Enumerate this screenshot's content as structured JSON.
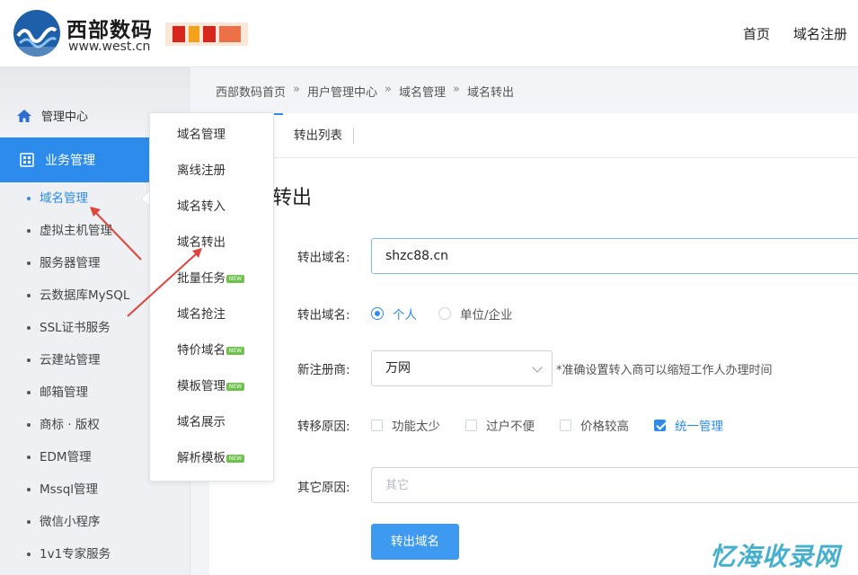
{
  "header": {
    "logo_cn": "西部数码",
    "logo_en": "www.west.cn",
    "nav": [
      "首页",
      "域名注册"
    ]
  },
  "sidebar": {
    "management_center": "管理中心",
    "business_management": "业务管理",
    "items": [
      {
        "label": "域名管理",
        "active": true
      },
      {
        "label": "虚拟主机管理",
        "active": false
      },
      {
        "label": "服务器管理",
        "active": false
      },
      {
        "label": "云数据库MySQL",
        "active": false
      },
      {
        "label": "SSL证书服务",
        "active": false
      },
      {
        "label": "云建站管理",
        "active": false
      },
      {
        "label": "邮箱管理",
        "active": false
      },
      {
        "label": "商标 · 版权",
        "active": false
      },
      {
        "label": "EDM管理",
        "active": false
      },
      {
        "label": "Mssql管理",
        "active": false
      },
      {
        "label": "微信小程序",
        "active": false
      },
      {
        "label": "1v1专家服务",
        "active": false
      }
    ]
  },
  "flyout": {
    "items": [
      {
        "label": "域名管理",
        "new": false
      },
      {
        "label": "离线注册",
        "new": false
      },
      {
        "label": "域名转入",
        "new": false
      },
      {
        "label": "域名转出",
        "new": false
      },
      {
        "label": "批量任务",
        "new": true
      },
      {
        "label": "域名抢注",
        "new": false
      },
      {
        "label": "特价域名",
        "new": true
      },
      {
        "label": "模板管理",
        "new": true
      },
      {
        "label": "域名展示",
        "new": false
      },
      {
        "label": "解析模板",
        "new": true
      }
    ],
    "new_badge": "NEW"
  },
  "breadcrumb": [
    "西部数码首页",
    "用户管理中心",
    "域名管理",
    "域名转出"
  ],
  "breadcrumb_sep": "»",
  "tabs": {
    "list": "转出列表"
  },
  "page_title": "转出",
  "form": {
    "domain_label": "转出域名:",
    "domain_value": "shzc88.cn",
    "type_label": "转出域名:",
    "type_options": [
      {
        "label": "个人",
        "checked": true
      },
      {
        "label": "单位/企业",
        "checked": false
      }
    ],
    "registrar_label": "新注册商:",
    "registrar_value": "万网",
    "registrar_hint": "*准确设置转入商可以缩短工作人办理时间",
    "reason_label": "转移原因:",
    "reasons": [
      {
        "label": "功能太少",
        "checked": false
      },
      {
        "label": "过户不便",
        "checked": false
      },
      {
        "label": "价格较高",
        "checked": false
      },
      {
        "label": "统一管理",
        "checked": true
      }
    ],
    "other_label": "其它原因:",
    "other_placeholder": "其它",
    "submit_label": "转出域名"
  },
  "watermark": "忆海收录网",
  "colors": {
    "accent": "#2d8ceb",
    "badge": "#6cc24a",
    "arrow": "#e0443a"
  }
}
